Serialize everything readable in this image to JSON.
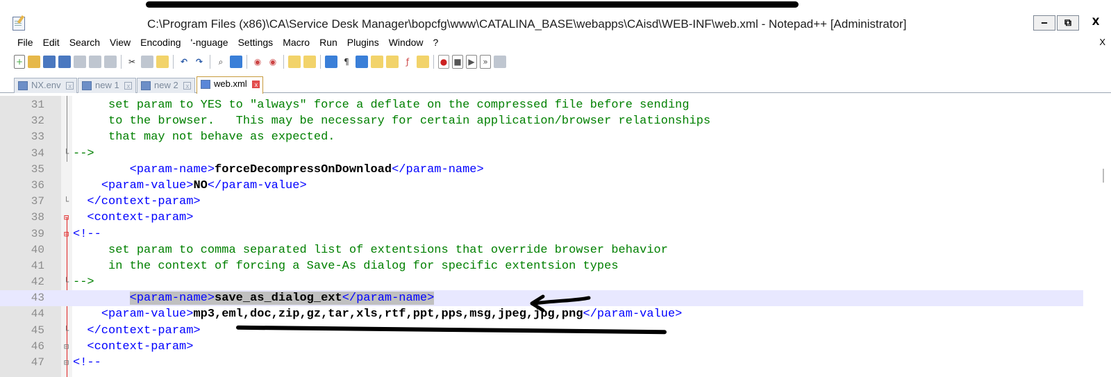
{
  "window": {
    "title": "C:\\Program Files (x86)\\CA\\Service Desk Manager\\bopcfg\\www\\CATALINA_BASE\\webapps\\CAisd\\WEB-INF\\web.xml - Notepad++ [Administrator]",
    "buttons": {
      "minimize": "‒",
      "restore": "⧉",
      "close": "X"
    }
  },
  "menu": {
    "items": [
      "File",
      "Edit",
      "Search",
      "View",
      "Encoding",
      "'-nguage",
      "Settings",
      "Macro",
      "Run",
      "Plugins",
      "Window",
      "?"
    ],
    "close_glyph": "X"
  },
  "toolbar": {
    "icons": [
      "new-file-icon",
      "open-file-icon",
      "save-icon",
      "save-all-icon",
      "close-icon",
      "close-all-icon",
      "print-icon",
      "cut-icon",
      "copy-icon",
      "paste-icon",
      "undo-icon",
      "redo-icon",
      "find-icon",
      "replace-icon",
      "zoom-in-icon",
      "zoom-out-icon",
      "sync-v-icon",
      "sync-h-icon",
      "wrap-icon",
      "all-chars-icon",
      "indent-guide-icon",
      "udl-icon",
      "doc-map-icon",
      "function-list-icon",
      "folder-icon",
      "record-macro-icon",
      "stop-macro-icon",
      "play-macro-icon",
      "run-macro-multi-icon",
      "save-macro-icon"
    ]
  },
  "tabs": [
    {
      "label": "NX.env",
      "close": "x",
      "active": false
    },
    {
      "label": "new 1",
      "close": "x",
      "active": false
    },
    {
      "label": "new 2",
      "close": "x",
      "active": false
    },
    {
      "label": "web.xml",
      "close": "x",
      "active": true
    }
  ],
  "editor": {
    "lines": [
      {
        "n": "31",
        "pre": "     ",
        "comment": "set param to YES to \"always\" force a deflate on the compressed file before sending"
      },
      {
        "n": "32",
        "pre": "     ",
        "comment": "to the browser.   This may be necessary for certain application/browser relationships"
      },
      {
        "n": "33",
        "pre": "     ",
        "comment": "that may not behave as expected."
      },
      {
        "n": "34",
        "pre": "",
        "comment": "-->"
      },
      {
        "n": "35",
        "pre": "        ",
        "open": "<param-name>",
        "text": "forceDecompressOnDownload",
        "close": "</param-name>"
      },
      {
        "n": "36",
        "pre": "    ",
        "open": "<param-value>",
        "text": "NO",
        "close": "</param-value>"
      },
      {
        "n": "37",
        "pre": "  ",
        "open": "</context-param>"
      },
      {
        "n": "38",
        "pre": "  ",
        "open": "<context-param>"
      },
      {
        "n": "39",
        "pre": "",
        "open": "<!--"
      },
      {
        "n": "40",
        "pre": "     ",
        "comment": "set param to comma separated list of extentsions that override browser behavior"
      },
      {
        "n": "41",
        "pre": "     ",
        "comment": "in the context of forcing a Save-As dialog for specific extentsion types"
      },
      {
        "n": "42",
        "pre": "",
        "comment": "-->"
      },
      {
        "n": "43",
        "pre": "        ",
        "open": "<param-name>",
        "text": "save_as_dialog_ext",
        "close": "</param-name>",
        "current": true
      },
      {
        "n": "44",
        "pre": "    ",
        "open": "<param-value>",
        "text": "mp3,eml,doc,zip,gz,tar,xls,rtf,ppt,pps,msg,jpeg,jpg,png",
        "close": "</param-value>"
      },
      {
        "n": "45",
        "pre": "  ",
        "open": "</context-param>"
      },
      {
        "n": "46",
        "pre": "  ",
        "open": "<context-param>"
      },
      {
        "n": "47",
        "pre": "",
        "open": "<!--"
      }
    ]
  },
  "colors": {
    "tag": "#0000ff",
    "comment": "#008000",
    "text": "#000000",
    "line_numbers": "#8c8c8c",
    "fold_markers": "#e02020",
    "current_line": "#e8e8ff"
  }
}
